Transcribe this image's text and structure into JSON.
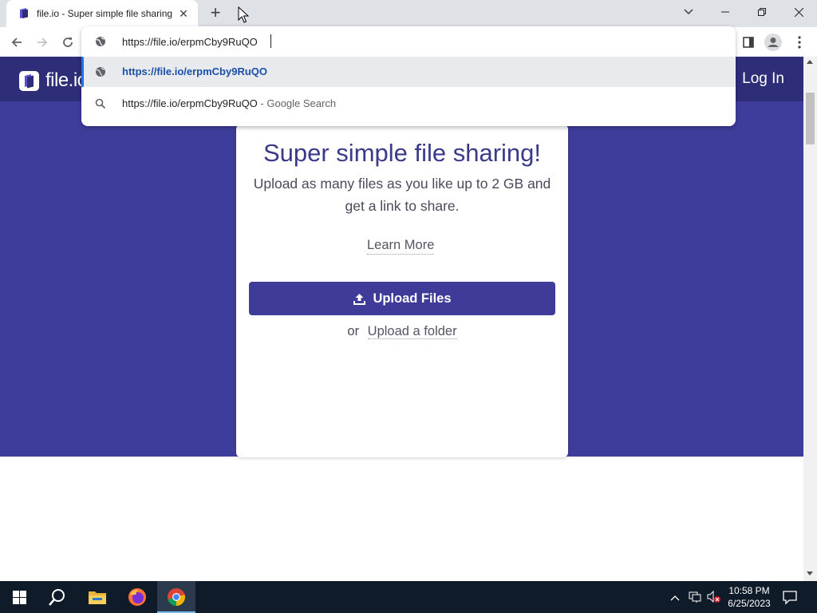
{
  "browser": {
    "tab": {
      "title": "file.io - Super simple file sharing",
      "favicon": "file-io-favicon",
      "close_icon": "close-icon"
    },
    "new_tab_icon": "plus-icon",
    "tab_search_icon": "chevron-down-icon",
    "window_controls": [
      "minimize-icon",
      "restore-icon",
      "close-icon"
    ],
    "toolbar": {
      "back_icon": "arrow-left-icon",
      "forward_icon": "arrow-right-icon",
      "reload_icon": "reload-icon",
      "side_panel_icon": "side-panel-icon",
      "profile_icon": "profile-icon",
      "menu_icon": "more-vert-icon"
    },
    "omnibox": {
      "value": "https://file.io/erpmCby9RuQO",
      "suggestions": [
        {
          "text": "https://file.io/erpmCby9RuQO",
          "suffix": "",
          "icon": "globe-icon",
          "selected": true
        },
        {
          "text": "https://file.io/erpmCby9RuQO",
          "suffix": " - Google Search",
          "icon": "search-icon",
          "selected": false
        }
      ]
    }
  },
  "site": {
    "logo_text": "file.io",
    "login_label": "Log In",
    "header_color": "#2e2d78",
    "hero_color": "#3f3d9b",
    "card": {
      "title": "Super simple file sharing!",
      "subtitle": "Upload as many files as you like up to 2 GB and get a link to share.",
      "learn_more": "Learn More",
      "upload_button": "Upload Files",
      "or_text": "or",
      "upload_folder": "Upload a folder"
    }
  },
  "taskbar": {
    "apps": [
      "windows-start-icon",
      "search-icon",
      "file-explorer-icon",
      "firefox-icon",
      "chrome-icon"
    ],
    "active_app": "chrome-icon",
    "tray_icons": [
      "chevron-up-icon",
      "network-icon",
      "volume-muted-icon"
    ],
    "time": "10:58 PM",
    "date": "6/25/2023",
    "notification_icon": "notification-icon"
  }
}
